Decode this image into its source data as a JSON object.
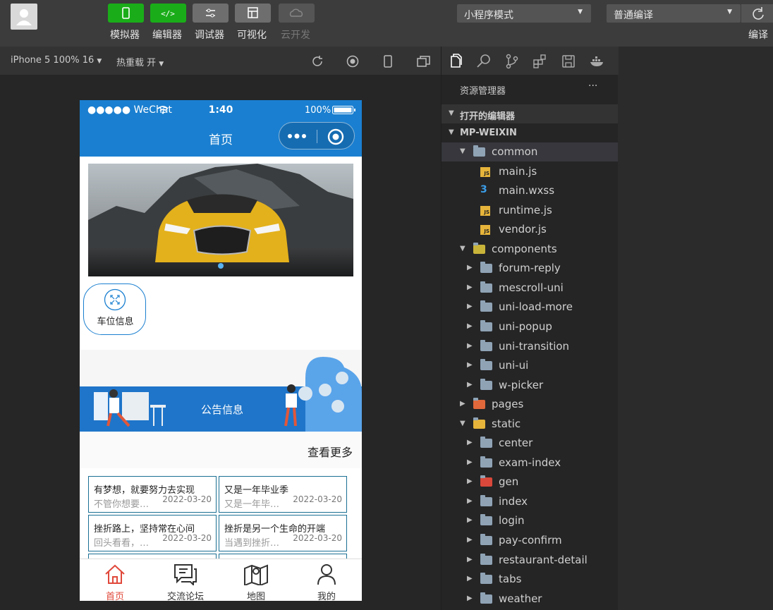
{
  "toolbar": {
    "buttons": [
      {
        "label": "模拟器",
        "color": "#1aad19"
      },
      {
        "label": "编辑器",
        "color": "#1aad19"
      },
      {
        "label": "调试器",
        "color": "#6e6e6e"
      },
      {
        "label": "可视化",
        "color": "#6e6e6e"
      },
      {
        "label": "云开发",
        "color": "#555555"
      }
    ],
    "mode_select": "小程序模式",
    "compile_select": "普通编译",
    "compile_label": "编译"
  },
  "sim_bar": {
    "device": "iPhone 5 100% 16",
    "hot_reload": "热重载 开"
  },
  "phone": {
    "status": {
      "carrier": "●●●●● WeChat",
      "time": "1:40",
      "battery": "100%"
    },
    "nav_title": "首页",
    "menu_label": "车位信息",
    "notice_title": "公告信息",
    "more": "查看更多",
    "cards": [
      {
        "title": "有梦想，就要努力去实现",
        "summary": "不管你想要…",
        "date": "2022-03-20"
      },
      {
        "title": "又是一年毕业季",
        "summary": "又是一年毕…",
        "date": "2022-03-20"
      },
      {
        "title": "挫折路上，坚持常在心间",
        "summary": "回头看看，…",
        "date": "2022-03-20"
      },
      {
        "title": "挫折是另一个生命的开端",
        "summary": "当遇到挫折…",
        "date": "2022-03-20"
      }
    ],
    "tabs": [
      {
        "label": "首页",
        "active": true
      },
      {
        "label": "交流论坛"
      },
      {
        "label": "地图"
      },
      {
        "label": "我的"
      }
    ]
  },
  "explorer": {
    "title": "资源管理器",
    "more": "···",
    "open_editors": "打开的编辑器",
    "project": "MP-WEIXIN",
    "tree": [
      {
        "name": "common",
        "level": 1,
        "open": true,
        "type": "folder"
      },
      {
        "name": "main.js",
        "level": 2,
        "type": "js"
      },
      {
        "name": "main.wxss",
        "level": 2,
        "type": "css"
      },
      {
        "name": "runtime.js",
        "level": 2,
        "type": "js"
      },
      {
        "name": "vendor.js",
        "level": 2,
        "type": "js"
      },
      {
        "name": "components",
        "level": 1,
        "open": true,
        "type": "folder-special"
      },
      {
        "name": "forum-reply",
        "level": 2,
        "type": "folder"
      },
      {
        "name": "mescroll-uni",
        "level": 2,
        "type": "folder"
      },
      {
        "name": "uni-load-more",
        "level": 2,
        "type": "folder"
      },
      {
        "name": "uni-popup",
        "level": 2,
        "type": "folder"
      },
      {
        "name": "uni-transition",
        "level": 2,
        "type": "folder"
      },
      {
        "name": "uni-ui",
        "level": 2,
        "type": "folder"
      },
      {
        "name": "w-picker",
        "level": 2,
        "type": "folder"
      },
      {
        "name": "pages",
        "level": 1,
        "type": "folder-pages"
      },
      {
        "name": "static",
        "level": 1,
        "open": true,
        "type": "folder-static"
      },
      {
        "name": "center",
        "level": 2,
        "type": "folder"
      },
      {
        "name": "exam-index",
        "level": 2,
        "type": "folder"
      },
      {
        "name": "gen",
        "level": 2,
        "type": "folder-red"
      },
      {
        "name": "index",
        "level": 2,
        "type": "folder"
      },
      {
        "name": "login",
        "level": 2,
        "type": "folder"
      },
      {
        "name": "pay-confirm",
        "level": 2,
        "type": "folder"
      },
      {
        "name": "restaurant-detail",
        "level": 2,
        "type": "folder"
      },
      {
        "name": "tabs",
        "level": 2,
        "type": "folder"
      },
      {
        "name": "weather",
        "level": 2,
        "type": "folder"
      }
    ]
  }
}
